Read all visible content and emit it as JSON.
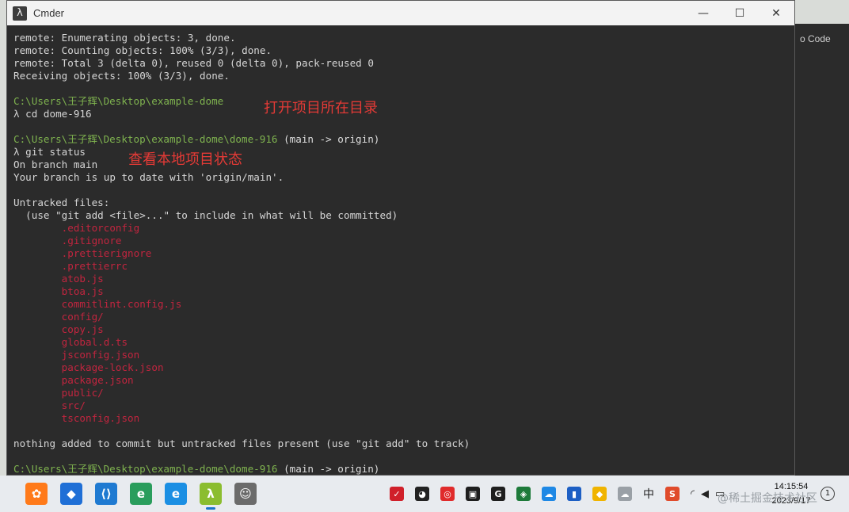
{
  "window": {
    "title": "Cmder",
    "icon": "lambda-icon",
    "controls": [
      "minimize-icon",
      "maximize-icon",
      "close-icon"
    ]
  },
  "terminal": {
    "lines": [
      {
        "type": "text",
        "text": "remote: Enumerating objects: 3, done."
      },
      {
        "type": "text",
        "text": "remote: Counting objects: 100% (3/3), done."
      },
      {
        "type": "text",
        "text": "remote: Total 3 (delta 0), reused 0 (delta 0), pack-reused 0"
      },
      {
        "type": "text",
        "text": "Receiving objects: 100% (3/3), done."
      },
      {
        "type": "blank",
        "text": ""
      },
      {
        "type": "path",
        "text": "C:\\Users\\王子辉\\Desktop\\example-dome",
        "suffix": ""
      },
      {
        "type": "cmd",
        "prompt": "λ",
        "text": "cd dome-916"
      },
      {
        "type": "blank",
        "text": ""
      },
      {
        "type": "path",
        "text": "C:\\Users\\王子辉\\Desktop\\example-dome\\dome-916",
        "suffix": " (main -> origin)"
      },
      {
        "type": "cmd",
        "prompt": "λ",
        "text": "git status"
      },
      {
        "type": "text",
        "text": "On branch main"
      },
      {
        "type": "text",
        "text": "Your branch is up to date with 'origin/main'."
      },
      {
        "type": "blank",
        "text": ""
      },
      {
        "type": "text",
        "text": "Untracked files:"
      },
      {
        "type": "text",
        "text": "  (use \"git add <file>...\" to include in what will be committed)"
      },
      {
        "type": "file",
        "text": "        .editorconfig"
      },
      {
        "type": "file",
        "text": "        .gitignore"
      },
      {
        "type": "file",
        "text": "        .prettierignore"
      },
      {
        "type": "file",
        "text": "        .prettierrc"
      },
      {
        "type": "file",
        "text": "        atob.js"
      },
      {
        "type": "file",
        "text": "        btoa.js"
      },
      {
        "type": "file",
        "text": "        commitlint.config.js"
      },
      {
        "type": "file",
        "text": "        config/"
      },
      {
        "type": "file",
        "text": "        copy.js"
      },
      {
        "type": "file",
        "text": "        global.d.ts"
      },
      {
        "type": "file",
        "text": "        jsconfig.json"
      },
      {
        "type": "file",
        "text": "        package-lock.json"
      },
      {
        "type": "file",
        "text": "        package.json"
      },
      {
        "type": "file",
        "text": "        public/"
      },
      {
        "type": "file",
        "text": "        src/"
      },
      {
        "type": "file",
        "text": "        tsconfig.json"
      },
      {
        "type": "blank",
        "text": ""
      },
      {
        "type": "text",
        "text": "nothing added to commit but untracked files present (use \"git add\" to track)"
      },
      {
        "type": "blank",
        "text": ""
      },
      {
        "type": "path",
        "text": "C:\\Users\\王子辉\\Desktop\\example-dome\\dome-916",
        "suffix": " (main -> origin)"
      }
    ],
    "annotations": [
      {
        "text": "打开项目所在目录"
      },
      {
        "text": "查看本地项目状态"
      }
    ],
    "colors": {
      "path": "#7fb34f",
      "untracked": "#c2253f",
      "annotation": "#e43a36",
      "background": "#2b2b2b"
    }
  },
  "background_window": {
    "text": "o Code"
  },
  "taskbar": {
    "apps": [
      {
        "name": "wifi-assistant-icon",
        "color": "#ff7a1a",
        "glyph": "✿"
      },
      {
        "name": "taskbar-app-icon",
        "color": "#1f6fd6",
        "glyph": "◆"
      },
      {
        "name": "vscode-icon",
        "color": "#1f7ad1",
        "glyph": "⟨⟩"
      },
      {
        "name": "edge-icon",
        "color": "#2a9d5c",
        "glyph": "e"
      },
      {
        "name": "ie-icon",
        "color": "#1b8fe3",
        "glyph": "e"
      },
      {
        "name": "cmder-icon",
        "color": "#8bbd2f",
        "glyph": "λ"
      },
      {
        "name": "avatar-app-icon",
        "color": "#6b6b6b",
        "glyph": "☺"
      }
    ],
    "tray": [
      {
        "name": "antivirus-icon",
        "color": "#d0202a",
        "glyph": "✓"
      },
      {
        "name": "qq-icon",
        "color": "#222222",
        "glyph": "◕"
      },
      {
        "name": "netease-music-icon",
        "color": "#e02b2b",
        "glyph": "◎"
      },
      {
        "name": "nvidia-icon",
        "color": "#1e1e1e",
        "glyph": "▣"
      },
      {
        "name": "logitech-icon",
        "color": "#1e1e1e",
        "glyph": "G"
      },
      {
        "name": "defender-icon",
        "color": "#1d7a3a",
        "glyph": "◈"
      },
      {
        "name": "onedrive-blue-icon",
        "color": "#1e88e5",
        "glyph": "☁"
      },
      {
        "name": "security-shield-icon",
        "color": "#1d5fc4",
        "glyph": "▮"
      },
      {
        "name": "shield-yellow-icon",
        "color": "#f0b400",
        "glyph": "◆"
      },
      {
        "name": "onedrive-icon",
        "color": "#9aa0a6",
        "glyph": "☁"
      }
    ],
    "ime": "中",
    "sogou": "S",
    "clock_time": "14:15:54",
    "clock_date": "2023/9/17",
    "watermark": "@稀土掘金技术社区"
  }
}
